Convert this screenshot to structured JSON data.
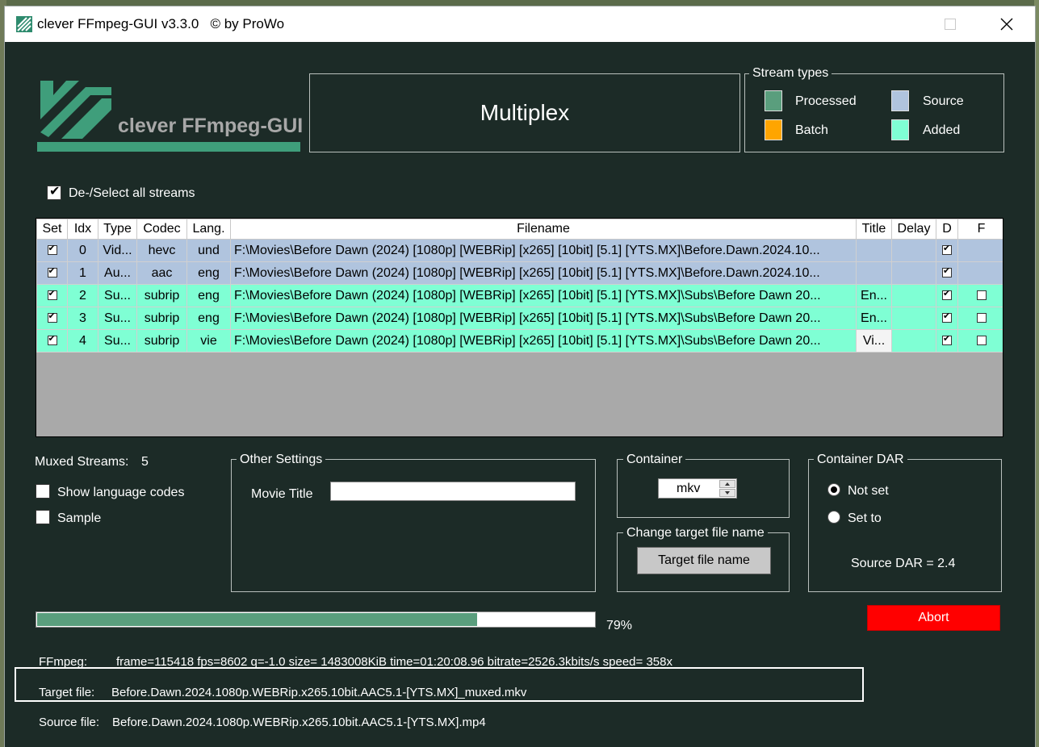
{
  "window": {
    "title": "clever FFmpeg-GUI v3.3.0   © by ProWo"
  },
  "logo": {
    "text": "clever FFmpeg-GUI",
    "color": "#3f9e7b"
  },
  "header": {
    "mode": "Multiplex"
  },
  "stream_types": {
    "title": "Stream types",
    "items": [
      {
        "label": "Processed",
        "color": "#5a9e7d"
      },
      {
        "label": "Source",
        "color": "#b0c4de"
      },
      {
        "label": "Batch",
        "color": "#ffa500"
      },
      {
        "label": "Added",
        "color": "#7fffd4"
      }
    ]
  },
  "select_all": {
    "label": "De-/Select all streams",
    "checked": true
  },
  "table": {
    "columns": [
      "Set",
      "Idx",
      "Type",
      "Codec",
      "Lang.",
      "Filename",
      "Title",
      "Delay",
      "D",
      "F"
    ],
    "rows": [
      {
        "kind": "source",
        "set": true,
        "idx": "0",
        "type": "Vid...",
        "codec": "hevc",
        "lang": "und",
        "filename": "F:\\Movies\\Before Dawn (2024) [1080p] [WEBRip] [x265] [10bit] [5.1] [YTS.MX]\\Before.Dawn.2024.10...",
        "title": "",
        "delay": "",
        "d": true,
        "f": null
      },
      {
        "kind": "source",
        "set": true,
        "idx": "1",
        "type": "Au...",
        "codec": "aac",
        "lang": "eng",
        "filename": "F:\\Movies\\Before Dawn (2024) [1080p] [WEBRip] [x265] [10bit] [5.1] [YTS.MX]\\Before.Dawn.2024.10...",
        "title": "",
        "delay": "",
        "d": true,
        "f": null
      },
      {
        "kind": "added",
        "set": true,
        "idx": "2",
        "type": "Su...",
        "codec": "subrip",
        "lang": "eng",
        "filename": "F:\\Movies\\Before Dawn (2024) [1080p] [WEBRip] [x265] [10bit] [5.1] [YTS.MX]\\Subs\\Before Dawn 20...",
        "title": "En...",
        "delay": "",
        "d": true,
        "f": false
      },
      {
        "kind": "added",
        "set": true,
        "idx": "3",
        "type": "Su...",
        "codec": "subrip",
        "lang": "eng",
        "filename": "F:\\Movies\\Before Dawn (2024) [1080p] [WEBRip] [x265] [10bit] [5.1] [YTS.MX]\\Subs\\Before Dawn 20...",
        "title": "En...",
        "delay": "",
        "d": true,
        "f": false
      },
      {
        "kind": "added",
        "set": true,
        "idx": "4",
        "type": "Su...",
        "codec": "subrip",
        "lang": "vie",
        "filename": "F:\\Movies\\Before Dawn (2024) [1080p] [WEBRip] [x265] [10bit] [5.1] [YTS.MX]\\Subs\\Before Dawn 20...",
        "title": "Vi...",
        "delay": "",
        "d": true,
        "f": false,
        "title_editing": true
      }
    ]
  },
  "muxed": {
    "label": "Muxed Streams:",
    "count": "5"
  },
  "options": {
    "show_language_codes": {
      "label": "Show language codes",
      "checked": false
    },
    "sample": {
      "label": "Sample",
      "checked": false
    }
  },
  "other_settings": {
    "title": "Other Settings",
    "movie_title_label": "Movie Title",
    "movie_title_value": ""
  },
  "container": {
    "title": "Container",
    "value": "mkv"
  },
  "change_target": {
    "title": "Change target file name",
    "button": "Target file name"
  },
  "dar": {
    "title": "Container DAR",
    "not_set": "Not set",
    "set_to": "Set to",
    "selected": "not_set",
    "source_dar": "Source DAR = 2.4"
  },
  "progress": {
    "percent": 79,
    "label": "79%"
  },
  "abort_button": {
    "label": "Abort",
    "color": "#ff0000"
  },
  "status": {
    "ffmpeg_label": "FFmpeg:",
    "ffmpeg_value": "frame=115418 fps=8602 q=-1.0 size= 1483008KiB time=01:20:08.96 bitrate=2526.3kbits/s speed= 358x",
    "target_label": "Target file:",
    "target_value": "Before.Dawn.2024.1080p.WEBRip.x265.10bit.AAC5.1-[YTS.MX]_muxed.mkv",
    "source_label": "Source file:",
    "source_value": "Before.Dawn.2024.1080p.WEBRip.x265.10bit.AAC5.1-[YTS.MX].mp4"
  }
}
